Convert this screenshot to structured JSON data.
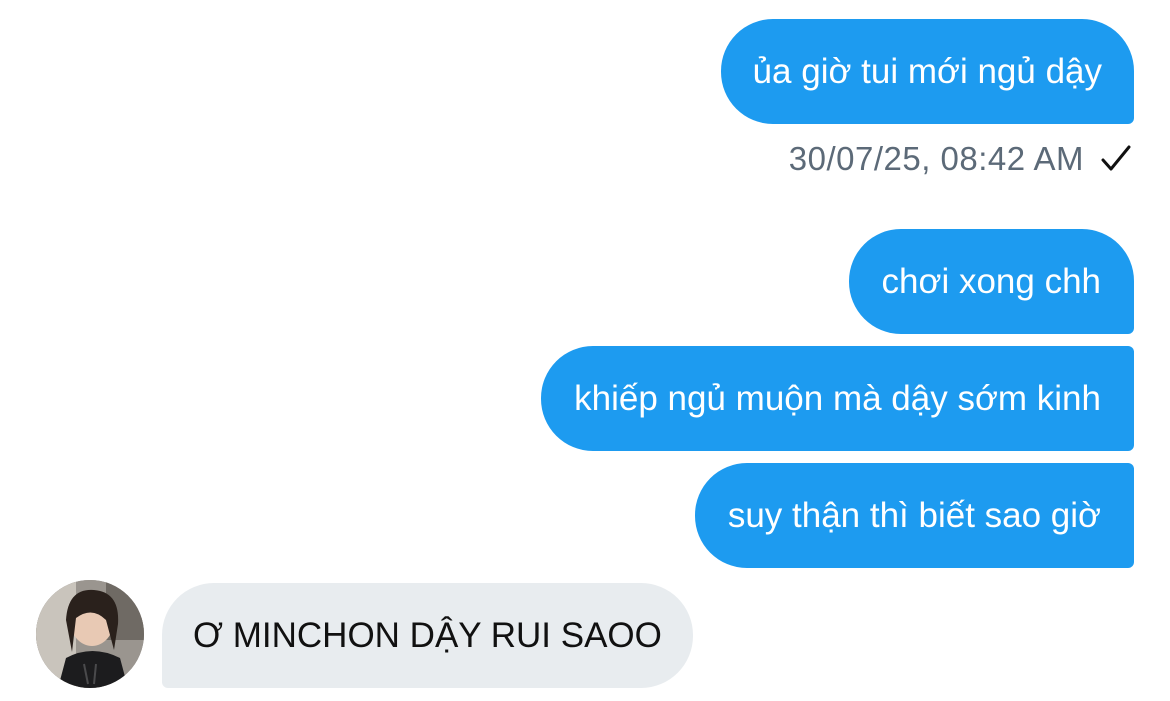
{
  "messages": [
    {
      "direction": "sent",
      "text": "ủa giờ tui mới ngủ dậy"
    },
    {
      "direction": "sent",
      "text": "chơi xong chh"
    },
    {
      "direction": "sent",
      "text": "khiếp ngủ muộn mà dậy sớm kinh"
    },
    {
      "direction": "sent",
      "text": "suy thận thì biết sao giờ"
    },
    {
      "direction": "received",
      "text": "Ơ MINCHON DẬY RUI SAOO"
    }
  ],
  "first_message_meta": {
    "timestamp": "30/07/25, 08:42 AM",
    "status_icon": "checkmark-icon"
  },
  "contact": {
    "avatar_icon": "avatar-photo"
  },
  "colors": {
    "sent_bubble": "#1d9bf0",
    "received_bubble": "#e8ecef",
    "timestamp_text": "#5c6a78"
  }
}
